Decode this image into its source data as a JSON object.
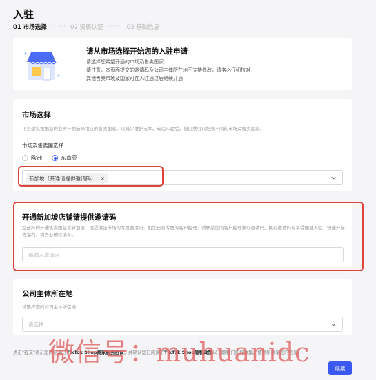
{
  "header": {
    "title": "入驻",
    "steps": [
      "01 市场选择",
      "02 资质认证",
      "03 基础信息"
    ],
    "separator": "······"
  },
  "intro": {
    "heading": "请从市场选择开始您的入驻申请",
    "lines": [
      "请选择您希望开通的市场及售卖国家",
      "请注意，本页面提交的邀请码及公司主体所在地不支持修改，请务必仔细核对",
      "其他售卖市场及国家可在入驻通过后继续开通"
    ]
  },
  "market": {
    "title": "市场选择",
    "desc": "平台建议根据您的业务计划选择相应的售卖国家，以减少维护成本，成功入驻后，您仍然可以拓展不同的市场及售卖国家。",
    "label": "市场及售卖国选择",
    "options": [
      "欧洲",
      "东南亚"
    ],
    "selected_option": "东南亚",
    "selected_tag": "新加坡（开通请提供邀请码）",
    "tag_close": "×"
  },
  "invite": {
    "title": "开通新加坡店铺请提供邀请码",
    "desc": "您选择的开通售卖国包含新加坡，请提供该市场的专属邀请码。如您已有专属的客户经理，请联系您的客户经理获取邀请码。拥有邀请码可享受便捷入驻、快速开店等福利，请务必确保填写。",
    "placeholder": "请输入邀请码"
  },
  "company": {
    "title": "公司主体所在地",
    "desc": "请选择您的公司主体所在地",
    "placeholder": "请选择"
  },
  "agreement": {
    "prefix": "点击\"提交\"表示您同意遵守",
    "link1": "TikTok Shop商家服务协议",
    "middle": "，并确认您已阅读了",
    "link2": "TikTok Shop隐私政策",
    "suffix": "以了解我们如何收集、使用和共享您的信息。"
  },
  "watermark": "微信号：muhuanidc",
  "footer": {
    "continue_label": "继续"
  },
  "colors": {
    "accent": "#3b58f0",
    "highlight": "#e0433b"
  }
}
